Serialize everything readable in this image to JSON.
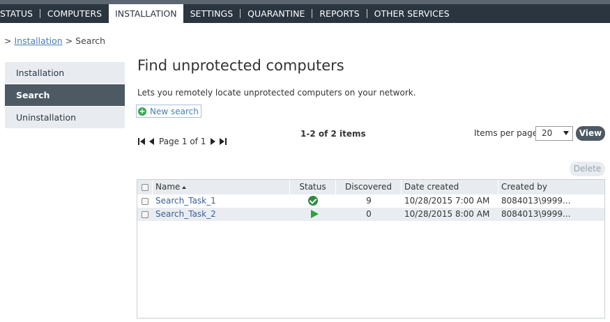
{
  "nav": {
    "items": [
      {
        "label": "STATUS"
      },
      {
        "label": "COMPUTERS"
      },
      {
        "label": "INSTALLATION"
      },
      {
        "label": "SETTINGS"
      },
      {
        "label": "QUARANTINE"
      },
      {
        "label": "REPORTS"
      },
      {
        "label": "OTHER SERVICES"
      }
    ],
    "active": "INSTALLATION"
  },
  "breadcrumb": {
    "prefix": ">",
    "link": "Installation",
    "separator": ">",
    "current": "Search"
  },
  "sidemenu": {
    "items": [
      {
        "label": "Installation"
      },
      {
        "label": "Search"
      },
      {
        "label": "Uninstallation"
      }
    ],
    "active": "Search"
  },
  "main": {
    "title": "Find unprotected computers",
    "description": "Lets you remotely locate unprotected computers on your network.",
    "new_search_label": "New search"
  },
  "pager": {
    "page_text": "Page 1 of 1",
    "items_count": "1-2 of 2 items",
    "items_per_page_label": "Items per page",
    "items_per_page_value": "20",
    "view_label": "View",
    "delete_label": "Delete"
  },
  "table": {
    "columns": [
      "Name",
      "Status",
      "Discovered",
      "Date created",
      "Created by"
    ],
    "rows": [
      {
        "name": "Search_Task_1",
        "status": "completed",
        "discovered": "9",
        "date_created": "10/28/2015 7:00 AM",
        "created_by": "8084013\\9999..."
      },
      {
        "name": "Search_Task_2",
        "status": "running",
        "discovered": "0",
        "date_created": "10/28/2015 8:00 AM",
        "created_by": "8084013\\9999..."
      }
    ]
  },
  "colors": {
    "nav_bg": "#2b3540",
    "active_side": "#4d5963",
    "link": "#4a7fb5",
    "status_ok": "#2e8b3e",
    "status_running": "#2aa53a"
  }
}
